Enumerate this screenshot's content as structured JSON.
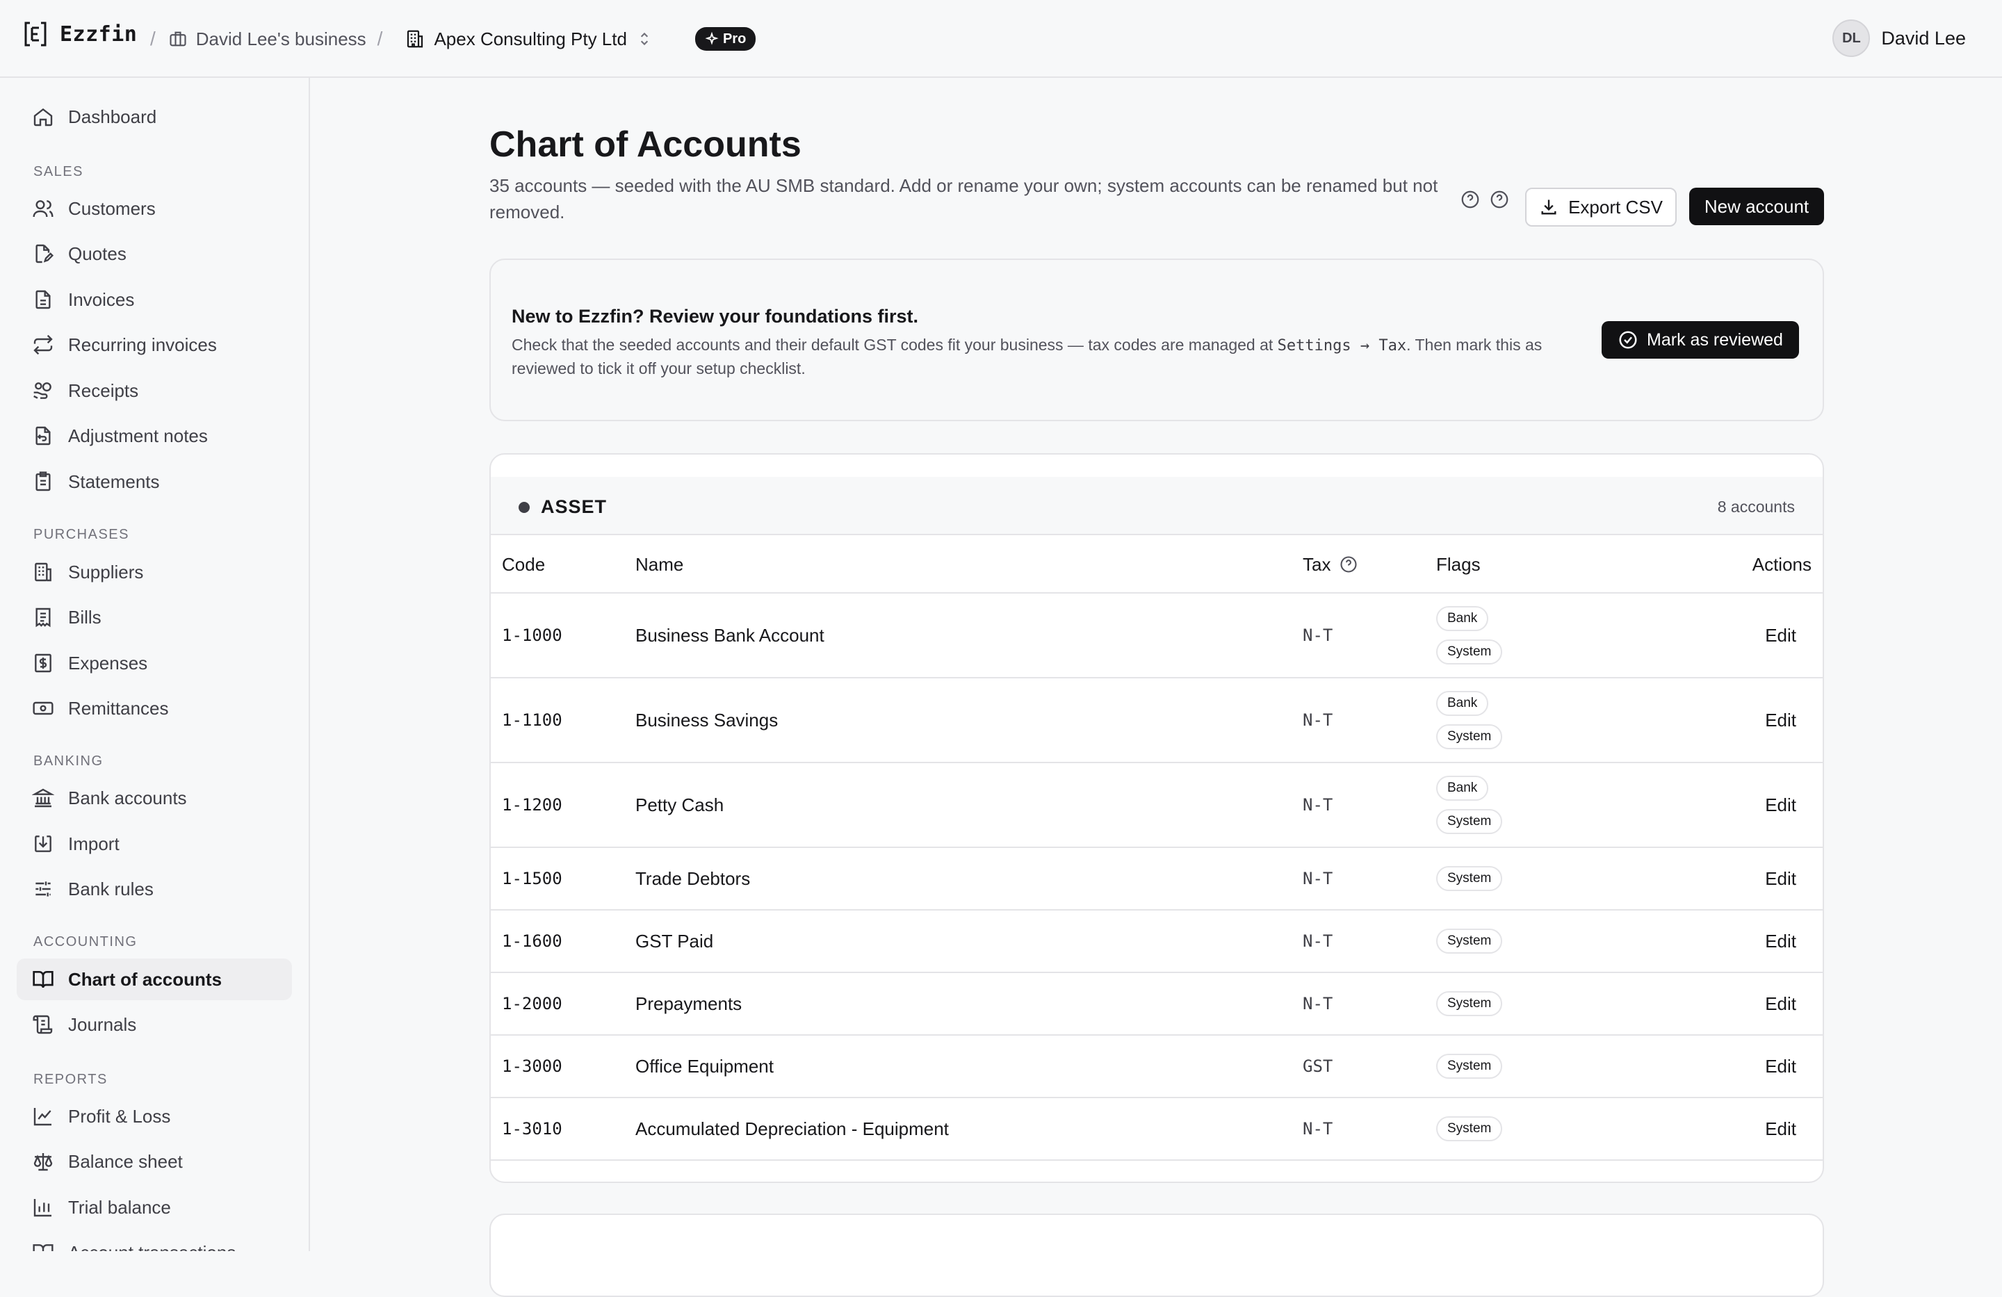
{
  "app": {
    "brand": "Ezzfin",
    "breadcrumb": {
      "business": "David Lee's business",
      "company": "Apex Consulting Pty Ltd",
      "plan_badge": "Pro"
    },
    "user": {
      "initials": "DL",
      "name": "David Lee"
    }
  },
  "sidebar": {
    "dashboard": "Dashboard",
    "sections": {
      "sales": "SALES",
      "purchases": "PURCHASES",
      "banking": "BANKING",
      "accounting": "ACCOUNTING",
      "reports": "REPORTS"
    },
    "items": {
      "customers": "Customers",
      "quotes": "Quotes",
      "invoices": "Invoices",
      "recurring_invoices": "Recurring invoices",
      "receipts": "Receipts",
      "adjustment_notes": "Adjustment notes",
      "statements": "Statements",
      "suppliers": "Suppliers",
      "bills": "Bills",
      "expenses": "Expenses",
      "remittances": "Remittances",
      "bank_accounts": "Bank accounts",
      "import": "Import",
      "bank_rules": "Bank rules",
      "chart_of_accounts": "Chart of accounts",
      "journals": "Journals",
      "profit_loss": "Profit & Loss",
      "balance_sheet": "Balance sheet",
      "trial_balance": "Trial balance",
      "account_transactions": "Account transactions"
    }
  },
  "page": {
    "title": "Chart of Accounts",
    "subtitle": "35 accounts — seeded with the AU SMB standard. Add or rename your own; system accounts can be renamed but not removed.",
    "export_label": "Export CSV",
    "new_account_label": "New account"
  },
  "notice": {
    "title": "New to Ezzfin? Review your foundations first.",
    "body_before": "Check that the seeded accounts and their default GST codes fit your business — tax codes are managed at ",
    "body_code": "Settings → Tax",
    "body_after": ". Then mark this as reviewed to tick it off your setup checklist.",
    "button": "Mark as reviewed"
  },
  "table": {
    "group": {
      "title": "ASSET",
      "count": "8 accounts"
    },
    "headers": {
      "code": "Code",
      "name": "Name",
      "tax": "Tax",
      "flags": "Flags",
      "actions": "Actions"
    },
    "edit_label": "Edit",
    "rows": [
      {
        "code": "1-1000",
        "name": "Business Bank Account",
        "tax": "N-T",
        "flags": [
          "Bank",
          "System"
        ]
      },
      {
        "code": "1-1100",
        "name": "Business Savings",
        "tax": "N-T",
        "flags": [
          "Bank",
          "System"
        ]
      },
      {
        "code": "1-1200",
        "name": "Petty Cash",
        "tax": "N-T",
        "flags": [
          "Bank",
          "System"
        ]
      },
      {
        "code": "1-1500",
        "name": "Trade Debtors",
        "tax": "N-T",
        "flags": [
          "System"
        ]
      },
      {
        "code": "1-1600",
        "name": "GST Paid",
        "tax": "N-T",
        "flags": [
          "System"
        ]
      },
      {
        "code": "1-2000",
        "name": "Prepayments",
        "tax": "N-T",
        "flags": [
          "System"
        ]
      },
      {
        "code": "1-3000",
        "name": "Office Equipment",
        "tax": "GST",
        "flags": [
          "System"
        ]
      },
      {
        "code": "1-3010",
        "name": "Accumulated Depreciation - Equipment",
        "tax": "N-T",
        "flags": [
          "System"
        ]
      }
    ]
  }
}
